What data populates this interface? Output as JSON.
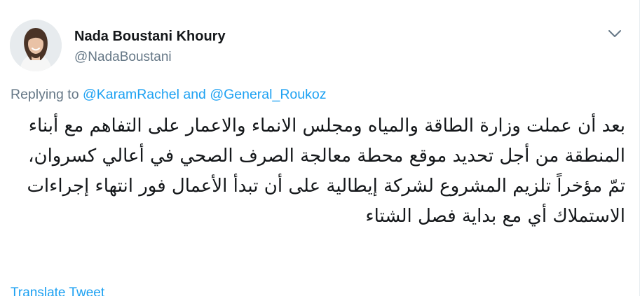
{
  "author": {
    "display_name": "Nada Boustani Khoury",
    "handle": "@NadaBoustani"
  },
  "reply_context": {
    "prefix": "Replying to",
    "mention_1": "@KaramRachel",
    "conjunction": "and",
    "mention_2": "@General_Roukoz"
  },
  "tweet": {
    "text": "بعد أن عملت وزارة الطاقة والمياه ومجلس الانماء والاعمار على التفاهم مع أبناء المنطقة من أجل تحديد موقع محطة معالجة الصرف الصحي في أعالي كسروان، تمّ مؤخراً تلزيم المشروع لشركة إيطالية على أن تبدأ الأعمال فور انتهاء إجراءات الاستملاك أي مع بداية فصل الشتاء"
  },
  "actions": {
    "translate_label": "Translate Tweet"
  },
  "icons": {
    "menu": "chevron-down-icon",
    "avatar": "profile-photo"
  },
  "colors": {
    "link": "#1da1f2",
    "secondary_text": "#657786",
    "primary_text": "#14171a"
  }
}
